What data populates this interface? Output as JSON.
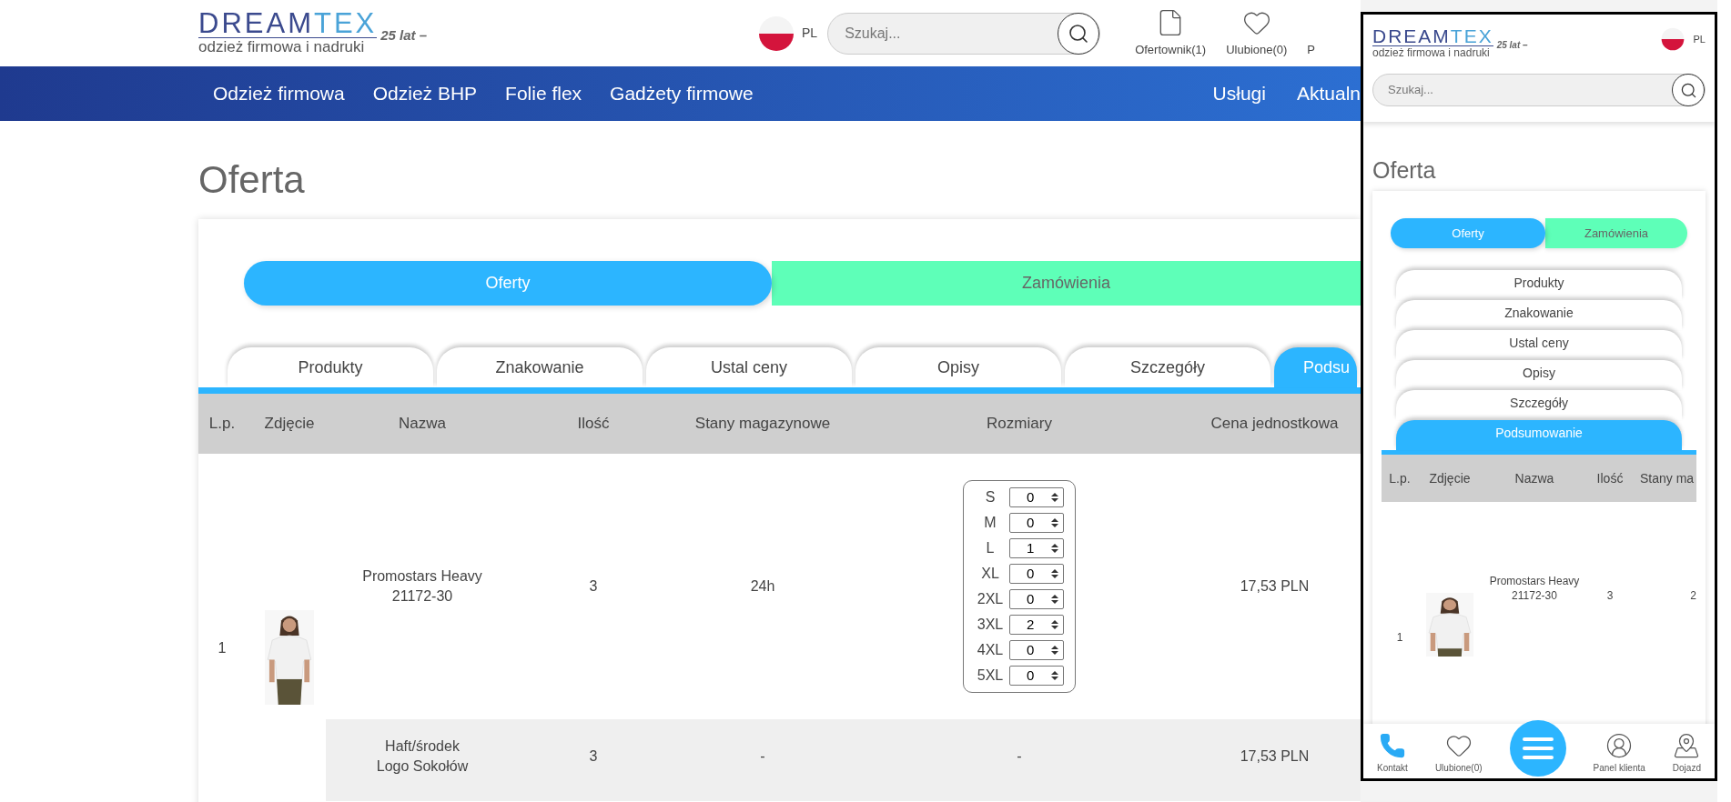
{
  "header": {
    "logo": {
      "brand_dark": "DREAM",
      "brand_light": "TEX",
      "tagline": "odzież firmowa i nadruki",
      "anniversary": "25 lat –"
    },
    "language": "PL",
    "search": {
      "placeholder": "Szukaj..."
    },
    "actions": [
      {
        "kind": "document",
        "label": "Ofertownik(1)"
      },
      {
        "kind": "heart",
        "label": "Ulubione(0)"
      },
      {
        "kind": "hidden",
        "label": "P"
      }
    ]
  },
  "nav": {
    "left": [
      "Odzież firmowa",
      "Odzież BHP",
      "Folie flex",
      "Gadżety firmowe"
    ],
    "right": [
      "Usługi",
      "Aktualn"
    ]
  },
  "page_title": "Oferta",
  "mode_toggle": [
    {
      "label": "Oferty",
      "selected": true
    },
    {
      "label": "Zamówienia",
      "selected": false
    }
  ],
  "tabs": [
    {
      "label": "Produkty",
      "selected": false
    },
    {
      "label": "Znakowanie",
      "selected": false
    },
    {
      "label": "Ustal ceny",
      "selected": false
    },
    {
      "label": "Opisy",
      "selected": false
    },
    {
      "label": "Szczegóły",
      "selected": false
    },
    {
      "label": "Podsu",
      "selected": true
    }
  ],
  "table": {
    "columns": [
      "L.p.",
      "Zdjęcie",
      "Nazwa",
      "Ilość",
      "Stany magazynowe",
      "Rozmiary",
      "Cena jednostkowa"
    ],
    "rows": [
      {
        "kind": "product",
        "lp": "1",
        "photo": {
          "kind": "picture"
        },
        "name": [
          "Promostars Heavy",
          "21172-30"
        ],
        "quantity": "3",
        "stock": "24h",
        "sizes": [
          {
            "label": "S",
            "value": "0"
          },
          {
            "label": "M",
            "value": "0"
          },
          {
            "label": "L",
            "value": "1"
          },
          {
            "label": "XL",
            "value": "0"
          },
          {
            "label": "2XL",
            "value": "0"
          },
          {
            "label": "3XL",
            "value": "2"
          },
          {
            "label": "4XL",
            "value": "0"
          },
          {
            "label": "5XL",
            "value": "0"
          }
        ],
        "price": "17,53 PLN"
      },
      {
        "kind": "marking",
        "name": [
          "Haft/środek",
          "Logo Sokołów"
        ],
        "quantity": "3",
        "stock": "-",
        "sizes_text": "-",
        "price": "17,53 PLN"
      }
    ]
  },
  "mobile_preview": {
    "logo": {
      "brand_dark": "DREAM",
      "brand_light": "TEX",
      "tagline": "odzież firmowa i nadruki",
      "anniversary": "25 lat –"
    },
    "language": "PL",
    "search": {
      "placeholder": "Szukaj..."
    },
    "page_title": "Oferta",
    "mode_toggle": [
      {
        "label": "Oferty",
        "selected": true
      },
      {
        "label": "Zamówienia",
        "selected": false
      }
    ],
    "tabs": [
      {
        "label": "Produkty",
        "selected": false
      },
      {
        "label": "Znakowanie",
        "selected": false
      },
      {
        "label": "Ustal ceny",
        "selected": false
      },
      {
        "label": "Opisy",
        "selected": false
      },
      {
        "label": "Szczegóły",
        "selected": false
      },
      {
        "label": "Podsumowanie",
        "selected": true
      }
    ],
    "columns": [
      "L.p.",
      "Zdjęcie",
      "Nazwa",
      "Ilość",
      "Stany ma"
    ],
    "row": {
      "lp": "1",
      "photo": {
        "kind": "picture"
      },
      "name": [
        "Promostars Heavy",
        "21172-30"
      ],
      "quantity": "3",
      "stock": "2"
    },
    "bottom_nav": [
      {
        "kind": "phone",
        "label": "Kontakt"
      },
      {
        "kind": "heart",
        "label": "Ulubione(0)"
      },
      {
        "kind": "menu"
      },
      {
        "kind": "user",
        "label": "Panel klienta"
      },
      {
        "kind": "map",
        "label": "Dojazd"
      }
    ]
  }
}
